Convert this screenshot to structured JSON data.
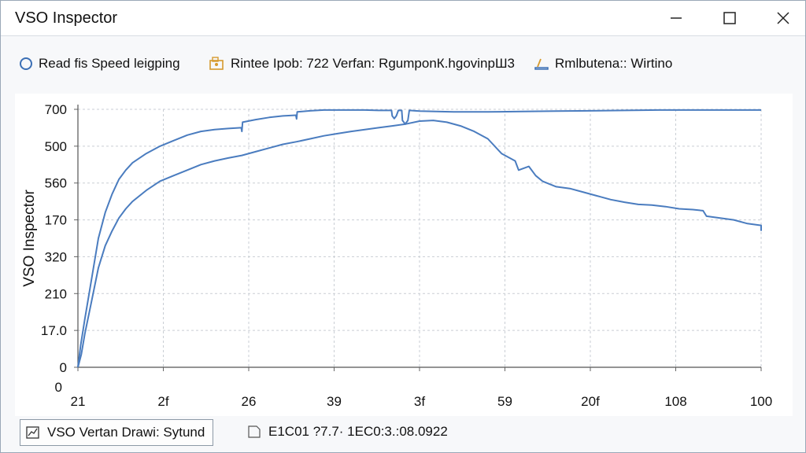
{
  "window": {
    "title": "VSO Inspector",
    "controls": [
      "minimize",
      "maximize",
      "close"
    ]
  },
  "toolbar": {
    "items": [
      {
        "label": "Read fis Speed leigping",
        "icon": "circle-icon"
      },
      {
        "label": "Rintee Ipob: 722 Verfan: RgumponК.hgovinpШ3",
        "icon": "folder-lock-icon"
      },
      {
        "label": "Rmlbutena:: Wirtino",
        "icon": "tray-icon"
      }
    ]
  },
  "status_bar": {
    "item1": {
      "label": "VSO Vertan Drawi: Sytund",
      "icon": "chart-icon"
    },
    "item2": {
      "label": "E1C01 ?7.7· 1EC0:3.:08.0922",
      "icon": "document-icon"
    }
  },
  "colors": {
    "series": "#4a7cbf",
    "grid": "#c9ced4",
    "titlebar": "#ffffff"
  },
  "chart_data": {
    "type": "line",
    "ylabel": "VSO Inspector",
    "xlabel": "",
    "y_tick_labels": [
      "0",
      "17.0",
      "210",
      "320",
      "170",
      "560",
      "500",
      "700"
    ],
    "x_tick_labels": [
      "21",
      "2f",
      "26",
      "39",
      "3f",
      "59",
      "20f",
      "108",
      "100"
    ],
    "extra_y_label": "0",
    "grid": true,
    "series": [
      {
        "points": [
          [
            0,
            0
          ],
          [
            0.4,
            60
          ],
          [
            1,
            130
          ],
          [
            2,
            240
          ],
          [
            3,
            350
          ],
          [
            4,
            420
          ],
          [
            5,
            470
          ],
          [
            6,
            510
          ],
          [
            7,
            535
          ],
          [
            8,
            555
          ],
          [
            10,
            580
          ],
          [
            12,
            600
          ],
          [
            14,
            615
          ],
          [
            16,
            630
          ],
          [
            18,
            640
          ],
          [
            20,
            645
          ],
          [
            22,
            648
          ],
          [
            23.9,
            650
          ],
          [
            24,
            640
          ],
          [
            24.1,
            665
          ],
          [
            26,
            672
          ],
          [
            28,
            678
          ],
          [
            30,
            682
          ],
          [
            31.9,
            684
          ],
          [
            32,
            674
          ],
          [
            32.1,
            693
          ],
          [
            34,
            696
          ],
          [
            36,
            698
          ],
          [
            38,
            698
          ],
          [
            40,
            698
          ],
          [
            42,
            698
          ],
          [
            44,
            697
          ],
          [
            45.9,
            697
          ],
          [
            46,
            682
          ],
          [
            46.3,
            675
          ],
          [
            46.6,
            682
          ],
          [
            46.9,
            697
          ],
          [
            47.4,
            697
          ],
          [
            47.5,
            670
          ],
          [
            47.9,
            660
          ],
          [
            48.3,
            670
          ],
          [
            48.5,
            697
          ],
          [
            50,
            695
          ],
          [
            55,
            693
          ],
          [
            60,
            693
          ],
          [
            65,
            694
          ],
          [
            70,
            695
          ],
          [
            75,
            696
          ],
          [
            80,
            697
          ],
          [
            85,
            698
          ],
          [
            100,
            698
          ]
        ]
      },
      {
        "points": [
          [
            0,
            0
          ],
          [
            0.5,
            35
          ],
          [
            1,
            90
          ],
          [
            2,
            180
          ],
          [
            3,
            270
          ],
          [
            4,
            330
          ],
          [
            5,
            370
          ],
          [
            6,
            405
          ],
          [
            7,
            430
          ],
          [
            8,
            450
          ],
          [
            10,
            480
          ],
          [
            12,
            505
          ],
          [
            14,
            520
          ],
          [
            16,
            535
          ],
          [
            18,
            550
          ],
          [
            20,
            560
          ],
          [
            22,
            568
          ],
          [
            24,
            575
          ],
          [
            26,
            585
          ],
          [
            28,
            595
          ],
          [
            30,
            605
          ],
          [
            32,
            612
          ],
          [
            34,
            620
          ],
          [
            36,
            628
          ],
          [
            38,
            634
          ],
          [
            40,
            640
          ],
          [
            42,
            645
          ],
          [
            44,
            650
          ],
          [
            46,
            655
          ],
          [
            48,
            660
          ],
          [
            50,
            668
          ],
          [
            52,
            670
          ],
          [
            54,
            665
          ],
          [
            56,
            655
          ],
          [
            58,
            640
          ],
          [
            60,
            620
          ],
          [
            62,
            580
          ],
          [
            64,
            560
          ],
          [
            64.5,
            535
          ],
          [
            66,
            545
          ],
          [
            67,
            520
          ],
          [
            68,
            505
          ],
          [
            70,
            490
          ],
          [
            72,
            485
          ],
          [
            74,
            475
          ],
          [
            76,
            465
          ],
          [
            78,
            455
          ],
          [
            80,
            448
          ],
          [
            82,
            442
          ],
          [
            84,
            440
          ],
          [
            86,
            436
          ],
          [
            88,
            430
          ],
          [
            90,
            428
          ],
          [
            91.5,
            425
          ],
          [
            92,
            410
          ],
          [
            94,
            405
          ],
          [
            96,
            400
          ],
          [
            98,
            390
          ],
          [
            100,
            385
          ],
          [
            100,
            370
          ]
        ]
      }
    ]
  }
}
